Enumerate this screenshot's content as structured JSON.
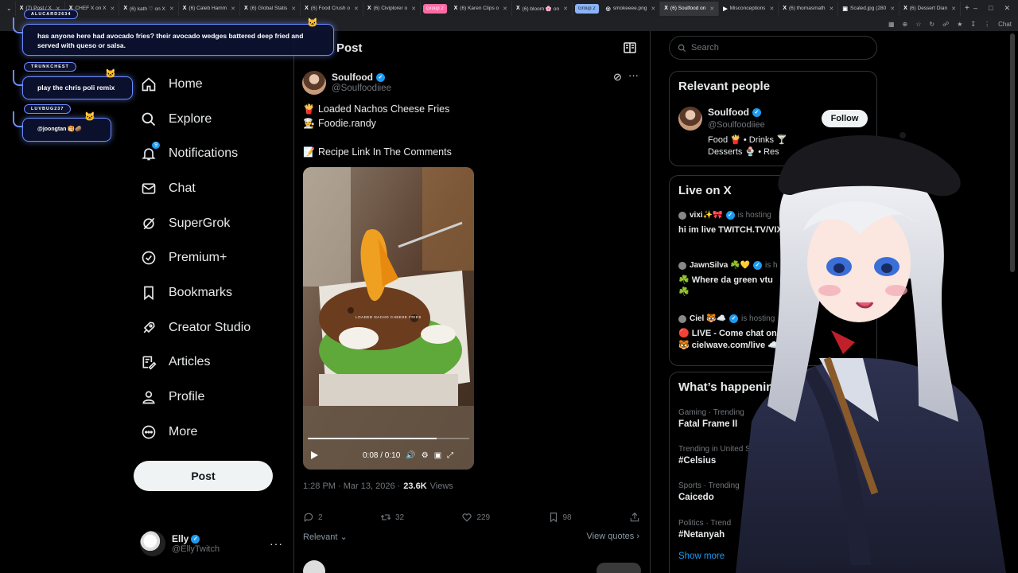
{
  "browser": {
    "tabs": [
      {
        "label": "(7) Post / X",
        "fav": "X"
      },
      {
        "label": "CHEF X on X",
        "fav": "X"
      },
      {
        "label": "(6) kath ♡ on X",
        "fav": "X"
      },
      {
        "label": "(6) Caleb Hamm",
        "fav": "X"
      },
      {
        "label": "(6) Global Statis",
        "fav": "X"
      },
      {
        "label": "(6) Food Crush o",
        "fav": "X"
      },
      {
        "label": "(6) Civiplorer o",
        "fav": "X"
      },
      {
        "label": "Group 2",
        "fav": "",
        "group": "pink"
      },
      {
        "label": "(6) Karen Clips o",
        "fav": "X"
      },
      {
        "label": "(6) bloom 🌸 on",
        "fav": "X"
      },
      {
        "label": "Group 2",
        "fav": "",
        "group": "blue"
      },
      {
        "label": "smokeeee.png",
        "fav": "◎"
      },
      {
        "label": "(6) Soulfood on",
        "fav": "X",
        "active": true
      },
      {
        "label": "Misconceptions",
        "fav": "▶"
      },
      {
        "label": "(6) thomasmath",
        "fav": "X"
      },
      {
        "label": "Scaled.jpg (280",
        "fav": "▣"
      },
      {
        "label": "(6) Dessert Dian",
        "fav": "X"
      }
    ],
    "new_tab": "+",
    "extension_label": "Chat"
  },
  "nav": {
    "items": [
      {
        "label": "Home",
        "icon": "home-icon"
      },
      {
        "label": "Explore",
        "icon": "search-icon"
      },
      {
        "label": "Notifications",
        "icon": "bell-icon",
        "badge": "9"
      },
      {
        "label": "Chat",
        "icon": "mail-icon"
      },
      {
        "label": "SuperGrok",
        "icon": "grok-icon"
      },
      {
        "label": "Premium+",
        "icon": "premium-icon"
      },
      {
        "label": "Bookmarks",
        "icon": "bookmark-icon"
      },
      {
        "label": "Creator Studio",
        "icon": "rocket-icon"
      },
      {
        "label": "Articles",
        "icon": "article-icon"
      },
      {
        "label": "Profile",
        "icon": "person-icon"
      },
      {
        "label": "More",
        "icon": "more-circle-icon"
      }
    ],
    "post_button": "Post"
  },
  "account": {
    "name": "Elly",
    "handle": "@EllyTwitch",
    "more": "···"
  },
  "post": {
    "header_title": "Post",
    "author_name": "Soulfood",
    "author_handle": "@Soulfoodiiee",
    "line1_emoji": "🍟",
    "line1": "Loaded Nachos Cheese Fries",
    "line2_emoji": "👨‍🍳",
    "line2": "Foodie.randy",
    "line3_emoji": "📝",
    "line3": "Recipe Link In The Comments",
    "media_caption": "LOADED NACHO CHEESE FRIES",
    "video_time": "0:08 / 0:10",
    "video_progress": 0.8,
    "time": "1:28 PM · Mar 13, 2026 ·",
    "views_count": "23.6K",
    "views_label": "Views",
    "replies": "2",
    "reposts": "32",
    "likes": "229",
    "bookmarks": "98",
    "sort_label": "Relevant",
    "view_quotes": "View quotes"
  },
  "sidebar": {
    "search_placeholder": "Search",
    "relevant_title": "Relevant people",
    "rp_name": "Soulfood",
    "rp_handle": "@Soulfoodiiee",
    "rp_bio": "Food 🍟 • Drinks 🍸 Desserts 🍨 • Res",
    "follow_label": "Follow",
    "live_title": "Live on X",
    "live": [
      {
        "host": "vixi✨🎀",
        "hosting": "is hosting",
        "title": "hi im live TWITCH.TV/VIX"
      },
      {
        "host": "JawnSilva ☘️💛",
        "hosting": "is h",
        "title": "☘️ Where da green vtu ☘️"
      },
      {
        "host": "Ciel 🐯☁️",
        "hosting": "is hosting",
        "title": "🔴 LIVE - Come chat on twitc 🐯 cielwave.com/live ☁️"
      }
    ],
    "happening_title": "What’s happenin",
    "trends": [
      {
        "category": "Gaming · Trending",
        "name": "Fatal Frame II"
      },
      {
        "category": "Trending in United S",
        "name": "#Celsius"
      },
      {
        "category": "Sports · Trending",
        "name": "Caicedo"
      },
      {
        "category": "Politics · Trend",
        "name": "#Netanyah"
      }
    ],
    "show_more": "Show more"
  },
  "overlay_chat": [
    {
      "user": "ALUCARD2634",
      "message": "has anyone here had avocado fries? their avocado wedges battered deep fried and served with queso or salsa."
    },
    {
      "user": "TRUNKCHEST",
      "message": "play the chris poli remix"
    },
    {
      "user": "LUVBUG237",
      "message": "@joongtan 🥞🥔"
    }
  ],
  "colors": {
    "accent": "#1d9bf0",
    "background": "#000000",
    "border": "#2f3336",
    "chat_border": "#6d8cff"
  }
}
